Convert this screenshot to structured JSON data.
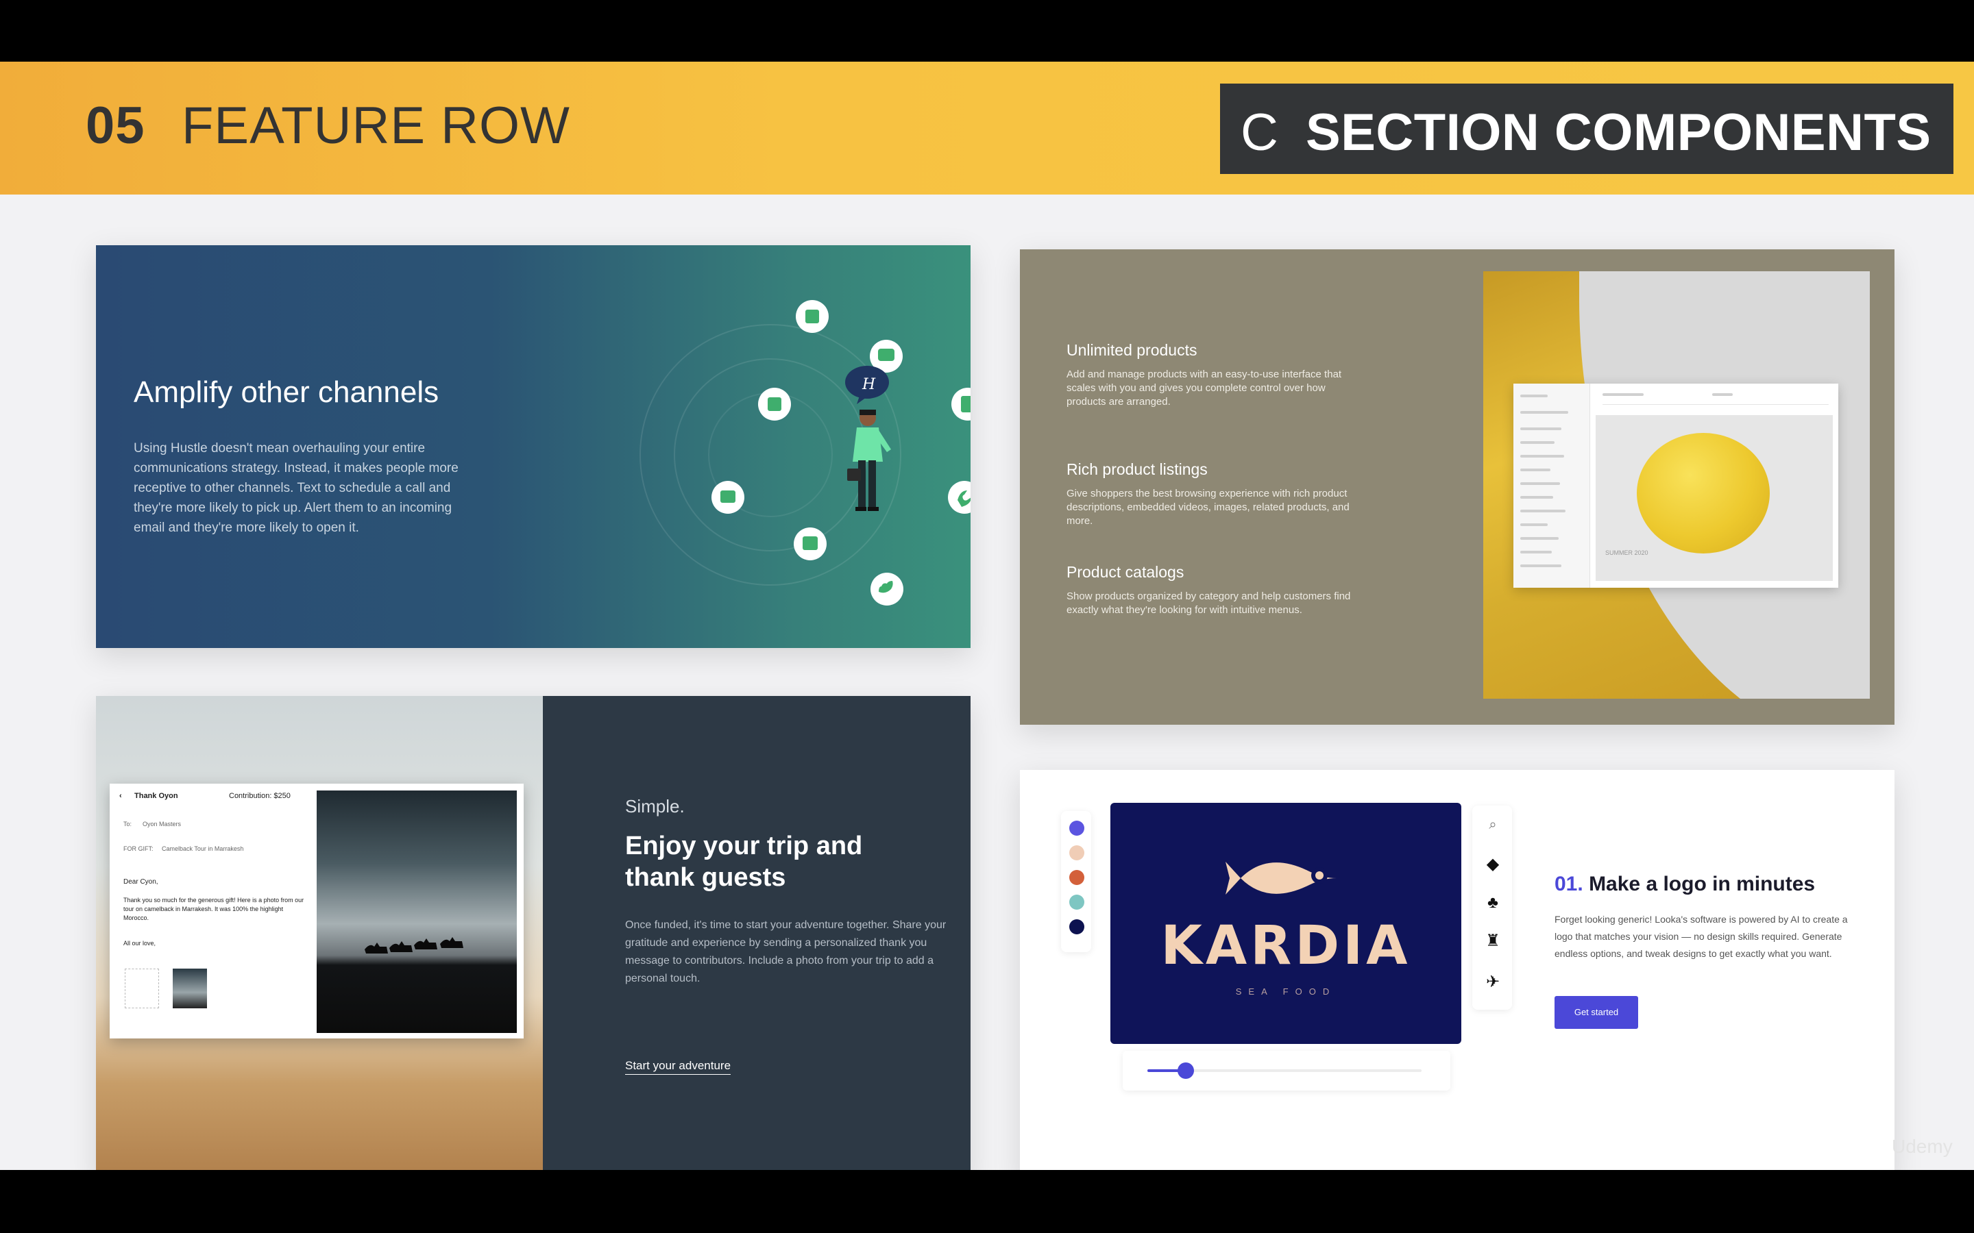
{
  "banner": {
    "number": "05",
    "title": "FEATURE ROW",
    "section_letter": "C",
    "section_title": "SECTION COMPONENTS"
  },
  "panel1": {
    "title": "Amplify other channels",
    "body": "Using Hustle doesn't mean overhauling your entire communications strategy. Instead, it makes people more receptive to other channels. Text to schedule a call and they're more likely to pick up. Alert them to an incoming email and they're more likely to open it.",
    "bubble_letter": "H"
  },
  "panel2": {
    "features": [
      {
        "title": "Unlimited products",
        "body": "Add and manage products with an easy-to-use interface that scales with you and gives you complete control over how products are arranged."
      },
      {
        "title": "Rich product listings",
        "body": "Give shoppers the best browsing experience with rich product descriptions, embedded videos, images, related products, and more."
      },
      {
        "title": "Product catalogs",
        "body": "Show products organized by category and help customers find exactly what they're looking for with intuitive menus."
      }
    ],
    "mock_caption": "SUMMER 2020"
  },
  "panel3": {
    "card": {
      "back_title": "Thank Oyon",
      "contribution": "Contribution: $250",
      "to_label": "To:",
      "to_value": "Oyon Masters",
      "for_label": "FOR GIFT:",
      "for_value": "Camelback Tour in Marrakesh",
      "greeting": "Dear Cyon,",
      "message": "Thank you so much for the generous gift! Here is a photo from our tour on camelback in Marrakesh. It was 100% the highlight Morocco.",
      "signoff": "All our love,"
    },
    "eyebrow": "Simple.",
    "title": "Enjoy your trip and thank guests",
    "body": "Once funded, it's time to start your adventure together. Share your gratitude and experience by sending a personalized thank you message to contributors. Include a photo from your trip to add a personal touch.",
    "link": "Start your adventure"
  },
  "panel4": {
    "swatches": [
      "#5b54e0",
      "#f0cdb6",
      "#d3603a",
      "#7ec6c2",
      "#0d1250"
    ],
    "logo_text": "KARDIA",
    "logo_sub": "SEA FOOD",
    "number": "01.",
    "title": "Make a logo in minutes",
    "body": "Forget looking generic! Looka's software is powered by AI to create a logo that matches your vision — no design skills required. Generate endless options, and tweak designs to get exactly what you want.",
    "button": "Get started",
    "slider_level": 0.14,
    "icons": [
      "search-icon",
      "fish-icon",
      "tree-icon",
      "lighthouse-icon",
      "fish-icon"
    ]
  },
  "watermark": "Udemy"
}
